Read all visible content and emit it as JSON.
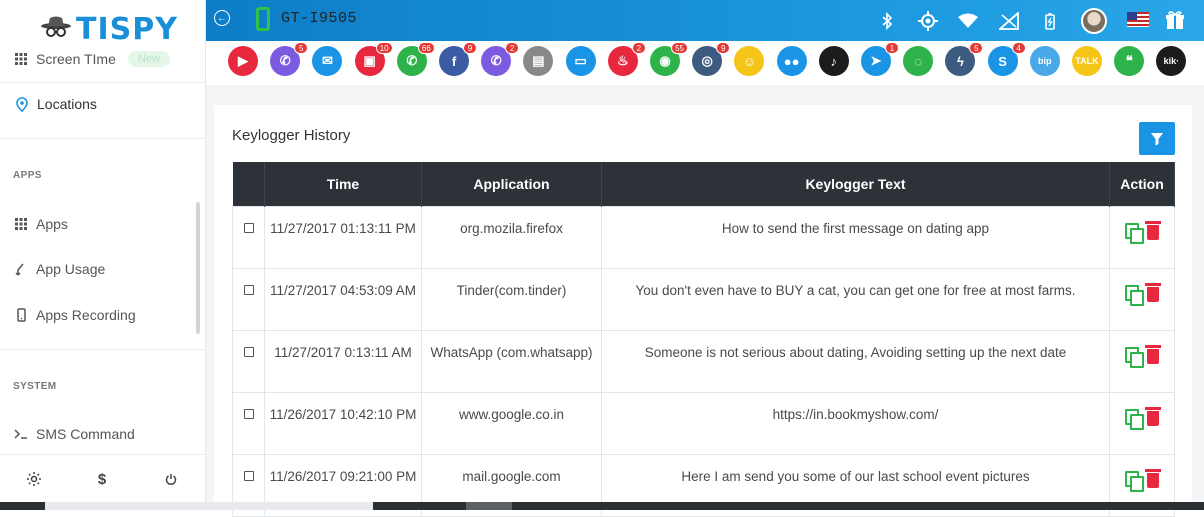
{
  "brand": {
    "name": "TISPY",
    "icon": "spy-hat-icon"
  },
  "sidebar": {
    "items": [
      {
        "label": "Screen TIme",
        "icon": "grid-icon",
        "badge": "New"
      },
      {
        "label": "Locations",
        "icon": "location-pin-icon"
      },
      {
        "label": "Apps",
        "icon": "grid-icon"
      },
      {
        "label": "App Usage",
        "icon": "app-usage-icon"
      },
      {
        "label": "Apps Recording",
        "icon": "mobile-icon"
      },
      {
        "label": "SMS Command",
        "icon": "terminal-icon"
      }
    ],
    "sections": [
      "APPS",
      "SYSTEM"
    ],
    "footer": [
      "settings-icon",
      "dollar-icon",
      "power-icon"
    ]
  },
  "topbar": {
    "device": "GT-I9505",
    "icons": [
      "back-icon",
      "phone-icon",
      "bluetooth-icon",
      "gps-icon",
      "wifi-icon",
      "signal-icon",
      "battery-icon",
      "avatar",
      "us-flag",
      "gift-icon"
    ]
  },
  "apps": [
    {
      "name": "camera",
      "color": "#e8283f",
      "glyph": "▶",
      "count": ""
    },
    {
      "name": "calls",
      "color": "#7b5ce0",
      "glyph": "✆",
      "count": "5"
    },
    {
      "name": "email",
      "color": "#1a95e6",
      "glyph": "✉",
      "count": ""
    },
    {
      "name": "photos",
      "color": "#e8283f",
      "glyph": "▣",
      "count": "10"
    },
    {
      "name": "whatsapp",
      "color": "#2eb34a",
      "glyph": "✆",
      "count": "66"
    },
    {
      "name": "facebook",
      "color": "#3b5ba5",
      "glyph": "f",
      "count": "9"
    },
    {
      "name": "viber",
      "color": "#7b5ce0",
      "glyph": "✆",
      "count": "2"
    },
    {
      "name": "clipboard",
      "color": "#888888",
      "glyph": "▤",
      "count": ""
    },
    {
      "name": "screen",
      "color": "#1a95e6",
      "glyph": "▭",
      "count": ""
    },
    {
      "name": "tinder",
      "color": "#e8283f",
      "glyph": "♨",
      "count": "2"
    },
    {
      "name": "wechat",
      "color": "#2eb34a",
      "glyph": "◉",
      "count": "55"
    },
    {
      "name": "instagram",
      "color": "#3d5a80",
      "glyph": "◎",
      "count": "9"
    },
    {
      "name": "snapchat",
      "color": "#f5c518",
      "glyph": "☺",
      "count": ""
    },
    {
      "name": "flickr",
      "color": "#1a95e6",
      "glyph": "●●",
      "count": ""
    },
    {
      "name": "tiktok",
      "color": "#1c1c1c",
      "glyph": "♪",
      "count": ""
    },
    {
      "name": "telegram",
      "color": "#1a95e6",
      "glyph": "➤",
      "count": "1"
    },
    {
      "name": "line",
      "color": "#2eb34a",
      "glyph": "◌",
      "count": ""
    },
    {
      "name": "messenger",
      "color": "#3d5a80",
      "glyph": "ϟ",
      "count": "5"
    },
    {
      "name": "skype",
      "color": "#1a95e6",
      "glyph": "S",
      "count": "4"
    },
    {
      "name": "bip",
      "color": "#4aa8e8",
      "glyph": "bip",
      "count": ""
    },
    {
      "name": "kakaotalk",
      "color": "#f5c518",
      "glyph": "TALK",
      "count": ""
    },
    {
      "name": "hangouts",
      "color": "#2eb34a",
      "glyph": "❝",
      "count": ""
    },
    {
      "name": "kik",
      "color": "#1c1c1c",
      "glyph": "kik·",
      "count": ""
    }
  ],
  "panel": {
    "title": "Keylogger History",
    "filter_icon": "filter-icon",
    "columns": [
      "",
      "Time",
      "Application",
      "Keylogger Text",
      "Action"
    ],
    "rows": [
      {
        "time": "11/27/2017 01:13:11 PM",
        "app": "org.mozila.firefox",
        "text": "How to send the first message on dating app"
      },
      {
        "time": "11/27/2017 04:53:09 AM",
        "app": "Tinder(com.tinder)",
        "text": "You don't even have to BUY a cat, you can get one for free at most farms."
      },
      {
        "time": "11/27/2017 0:13:11 AM",
        "app": "WhatsApp (com.whatsapp)",
        "text": "Someone is not serious about dating, Avoiding setting up the next date"
      },
      {
        "time": "11/26/2017 10:42:10 PM",
        "app": "www.google.co.in",
        "text": "https://in.bookmyshow.com/"
      },
      {
        "time": "11/26/2017 09:21:00 PM",
        "app": "mail.google.com",
        "text": "Here I am send you some of our last school event pictures"
      }
    ]
  },
  "colors": {
    "primary": "#1a95e6",
    "header_dark": "#2c3238",
    "copy": "#2eb34a",
    "delete": "#e8283f"
  }
}
